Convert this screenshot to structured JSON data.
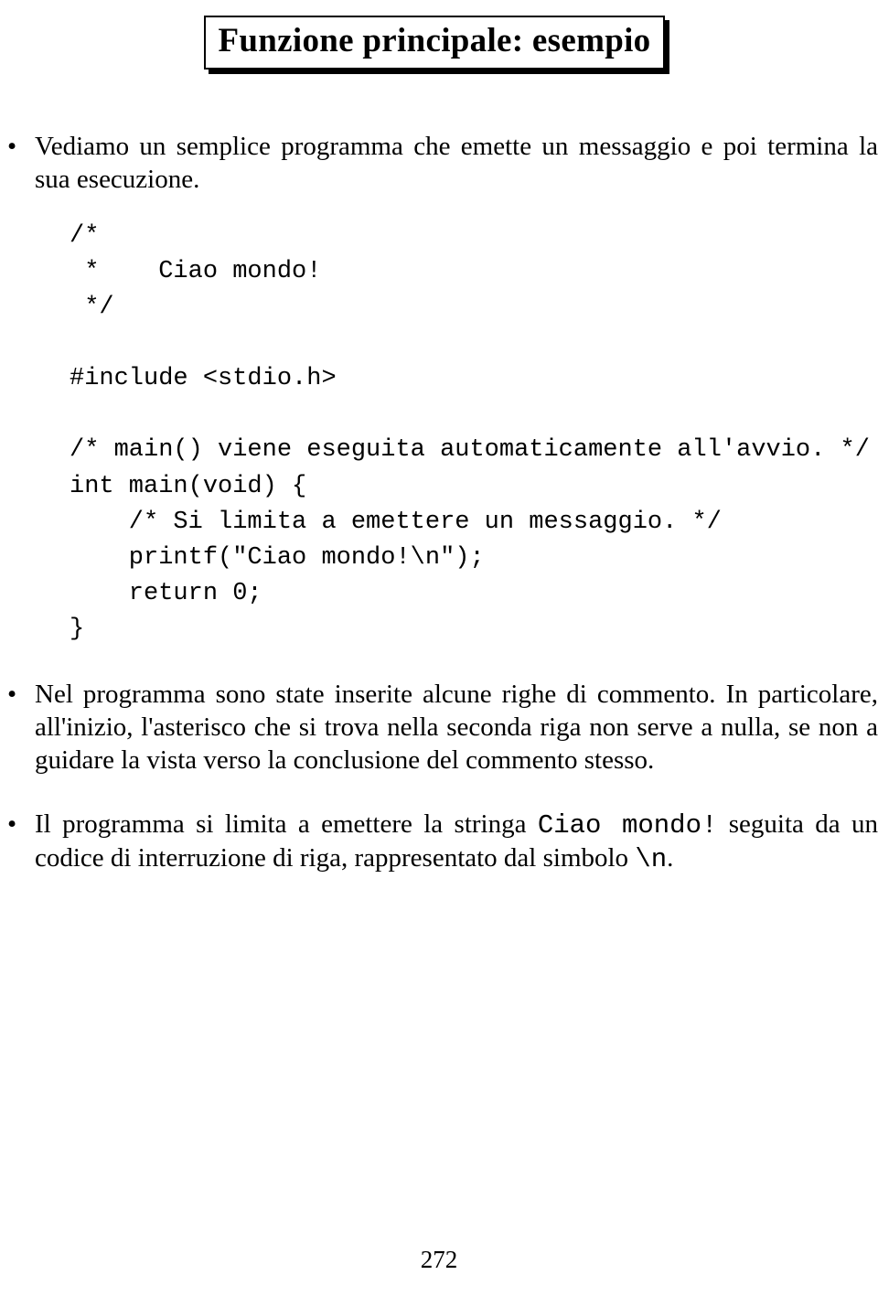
{
  "title": "Funzione principale: esempio",
  "bullet1": "Vediamo un semplice programma che emette un messaggio e poi termina la sua esecuzione.",
  "code1": "/*\n *    Ciao mondo!\n */\n\n#include <stdio.h>\n\n/* main() viene eseguita automaticamente all'avvio. */\nint main(void) {\n    /* Si limita a emettere un messaggio. */\n    printf(\"Ciao mondo!\\n\");\n    return 0;\n}",
  "bullet2": "Nel programma sono state inserite alcune righe di commento. In particolare, all'inizio, l'asterisco che si trova nella seconda riga non serve a nulla, se non a guidare la vista verso la conclusione del commento stesso.",
  "bullet3_pre": "Il programma si limita a emettere la stringa ",
  "bullet3_tt1": "Ciao mondo!",
  "bullet3_mid": " seguita da un codice di interruzione di riga, rappresentato dal simbolo ",
  "bullet3_tt2": "\\n",
  "bullet3_post": ".",
  "page_number": "272"
}
